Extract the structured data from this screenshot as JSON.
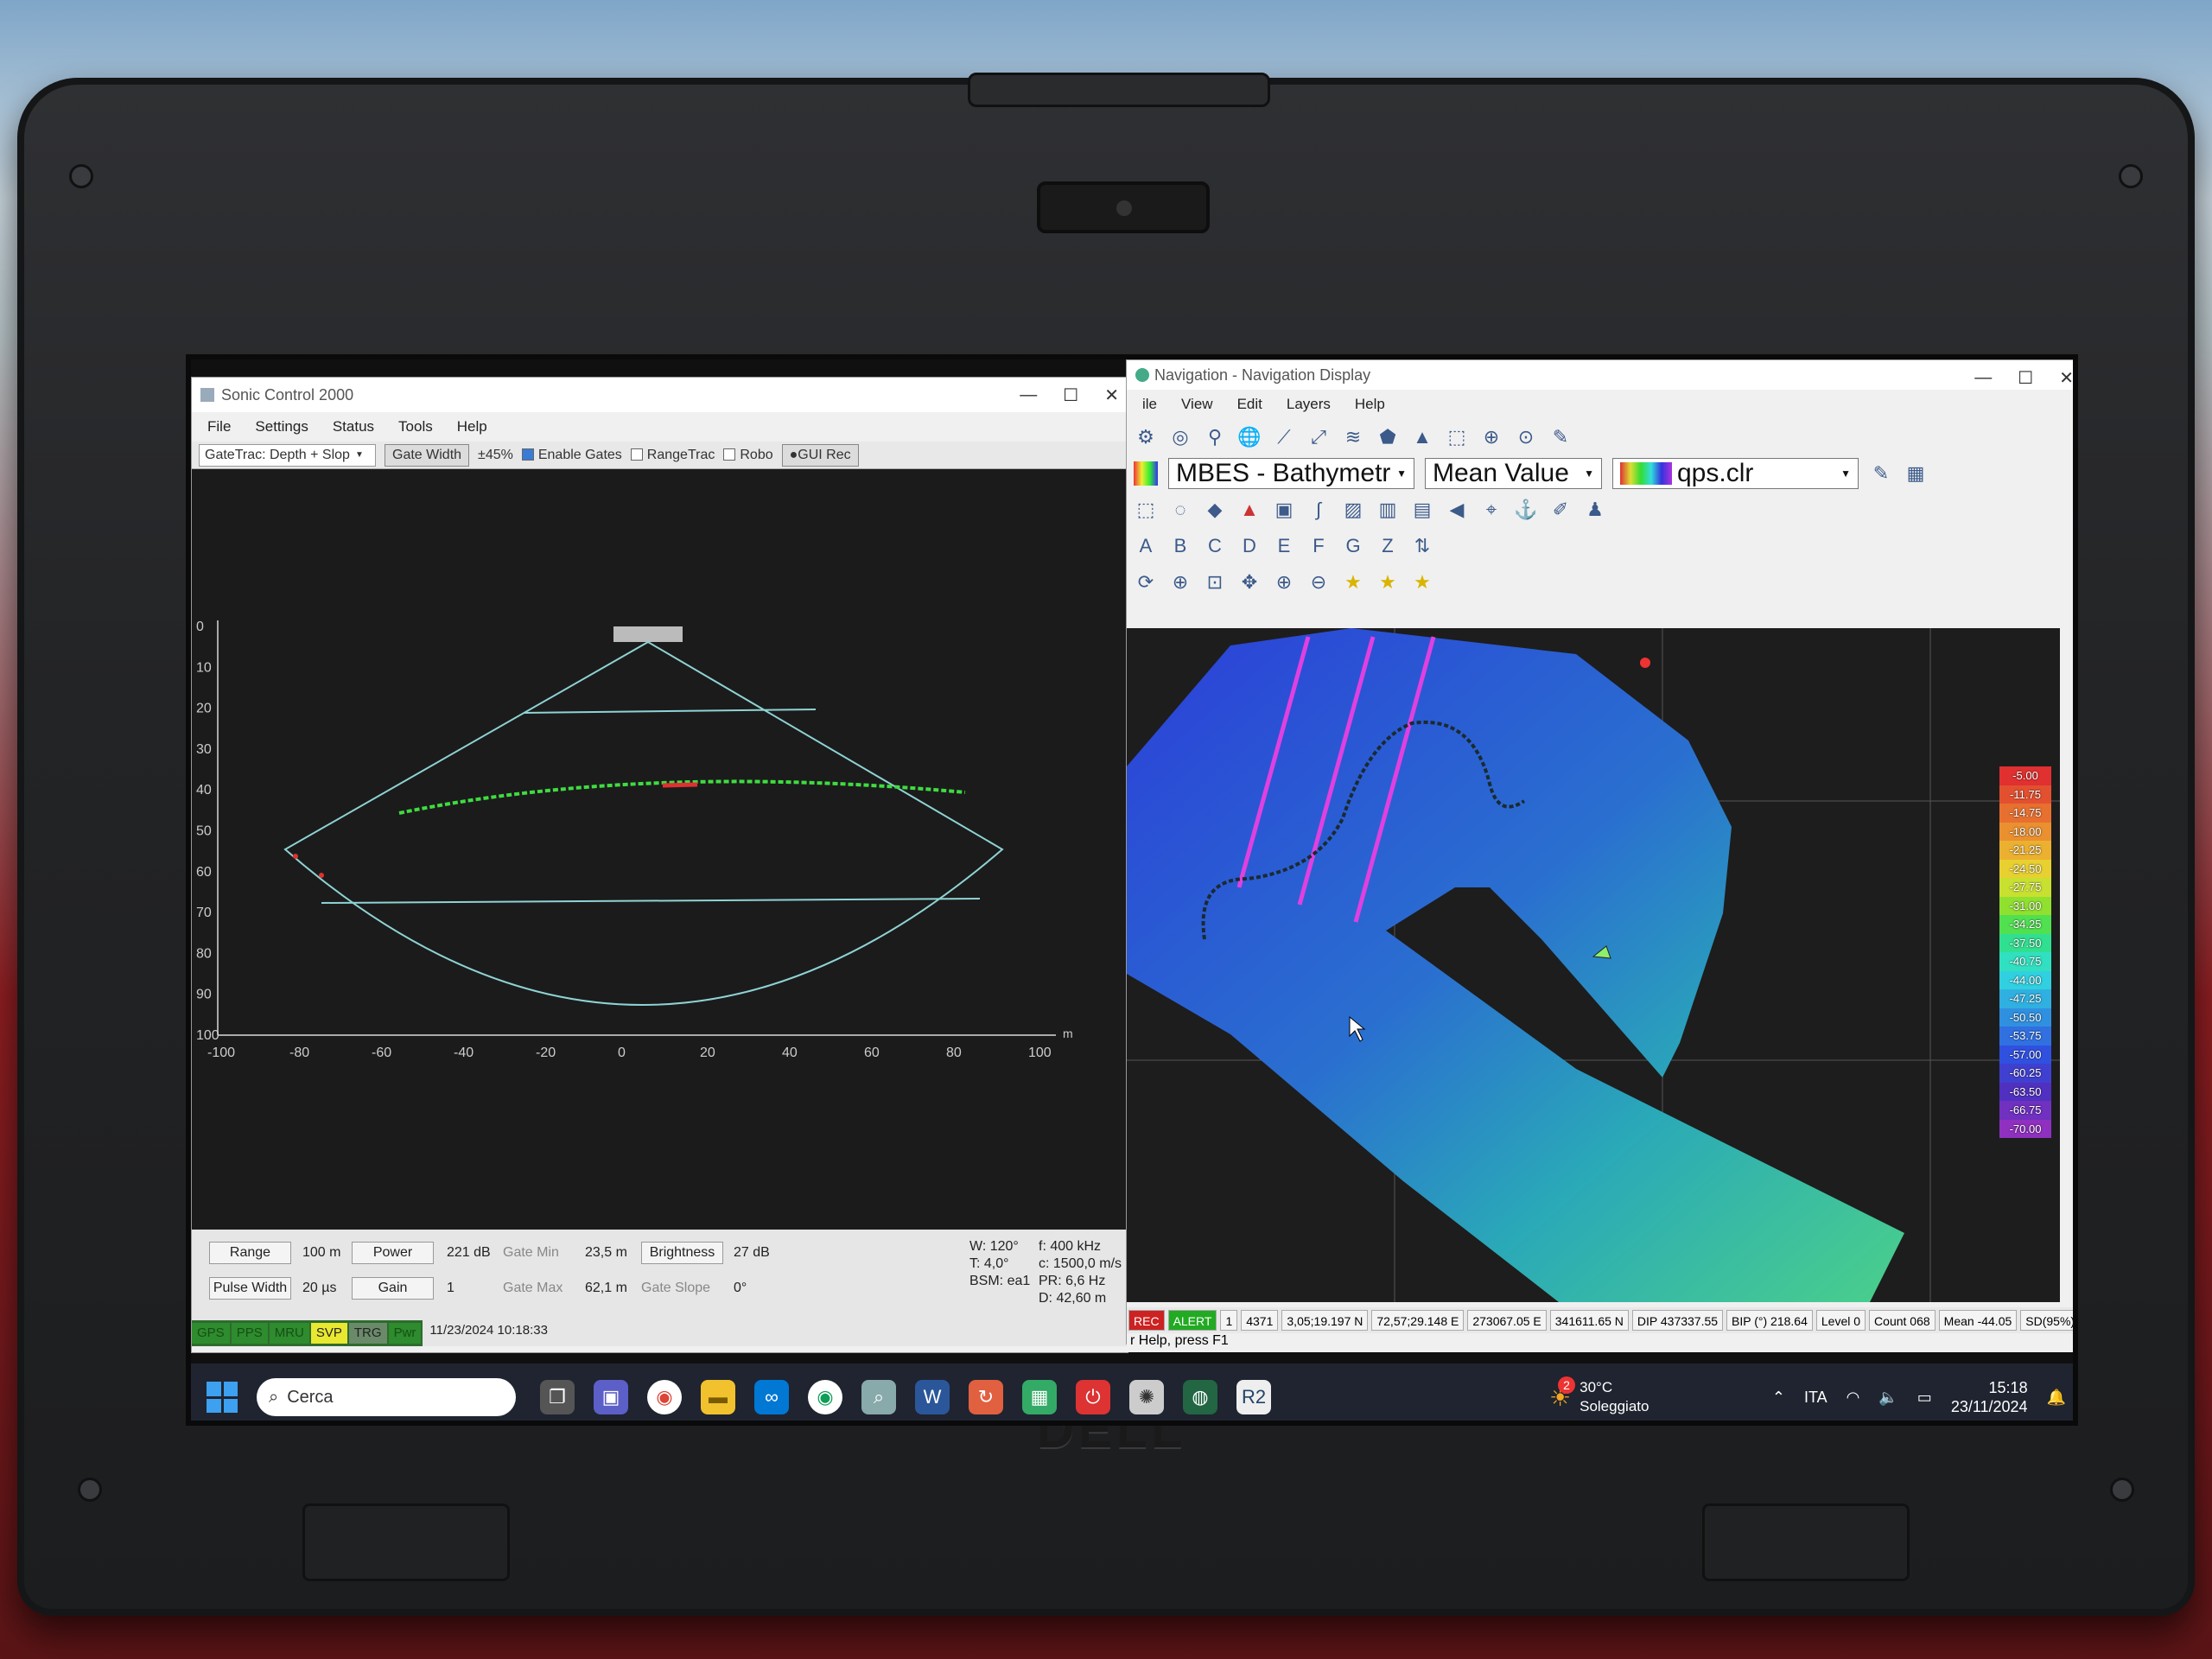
{
  "sonic": {
    "title": "Sonic Control 2000",
    "menu": [
      "File",
      "Settings",
      "Status",
      "Tools",
      "Help"
    ],
    "toolbar": {
      "gatetrac": "GateTrac: Depth + Slop",
      "gate_width": "Gate Width",
      "gate_pct": "±45%",
      "enable_gates": "Enable Gates",
      "rangetrac": "RangeTrac",
      "robo": "Robo",
      "gui_rec": "GUI Rec"
    },
    "y_ticks": [
      "0",
      "10",
      "20",
      "30",
      "40",
      "50",
      "60",
      "70",
      "80",
      "90",
      "100"
    ],
    "x_ticks": [
      "-100",
      "-80",
      "-60",
      "-40",
      "-20",
      "0",
      "20",
      "40",
      "60",
      "80",
      "100"
    ],
    "unit_m": "m",
    "params": {
      "range_label": "Range",
      "range_value": "100 m",
      "power_label": "Power",
      "power_value": "221 dB",
      "gate_min_label": "Gate Min",
      "gate_min_value": "23,5 m",
      "brightness_label": "Brightness",
      "brightness_value": "27 dB",
      "pulse_label": "Pulse Width",
      "pulse_value": "20 µs",
      "gain_label": "Gain",
      "gain_value": "1",
      "gate_max_label": "Gate Max",
      "gate_max_value": "62,1 m",
      "gate_slope_label": "Gate Slope",
      "gate_slope_value": "0°"
    },
    "info": {
      "w": "W: 120°",
      "t": "T: 4,0°",
      "bsm": "BSM: ea1",
      "f": "f: 400 kHz",
      "c": "c: 1500,0 m/s",
      "pr": "PR: 6,6 Hz",
      "d": "D: 42,60 m"
    },
    "status_tags": [
      "GPS",
      "PPS",
      "MRU",
      "SVP",
      "TRG",
      "Pwr"
    ],
    "timestamp": "11/23/2024 10:18:33"
  },
  "nav": {
    "title": "Navigation - Navigation Display",
    "menu": [
      "ile",
      "View",
      "Edit",
      "Layers",
      "Help"
    ],
    "layer_combo": "MBES - Bathymetr",
    "mode_combo": "Mean Value",
    "palette_combo": "qps.clr",
    "letters": [
      "A",
      "B",
      "C",
      "D",
      "E",
      "F",
      "G",
      "Z"
    ],
    "legend": [
      "-5.00",
      "-11.75",
      "-14.75",
      "-18.00",
      "-21.25",
      "-24.50",
      "-27.75",
      "-31.00",
      "-34.25",
      "-37.50",
      "-40.75",
      "-44.00",
      "-47.25",
      "-50.50",
      "-53.75",
      "-57.00",
      "-60.25",
      "-63.50",
      "-66.75",
      "-70.00"
    ],
    "status": [
      "REC",
      "ALERT",
      "1",
      "4371",
      "3,05;19.197 N",
      "72,57;29.148 E",
      "273067.05 E",
      "341611.65 N",
      "DIP 437337.55",
      "BIP (°) 218.64",
      "Level 0",
      "Count 068",
      "Mean -44.05",
      "SD(95%)"
    ],
    "help": "r Help, press F1"
  },
  "taskbar": {
    "search": "Cerca",
    "weather_temp": "30°C",
    "weather_desc": "Soleggiato",
    "weather_badge": "2",
    "lang": "ITA",
    "time": "15:18",
    "date": "23/11/2024"
  },
  "brand": "DELL",
  "colors": {
    "sonar_fan": "#8fd3d3",
    "bottom": "#3fdc3f",
    "track": "#e040e0"
  }
}
